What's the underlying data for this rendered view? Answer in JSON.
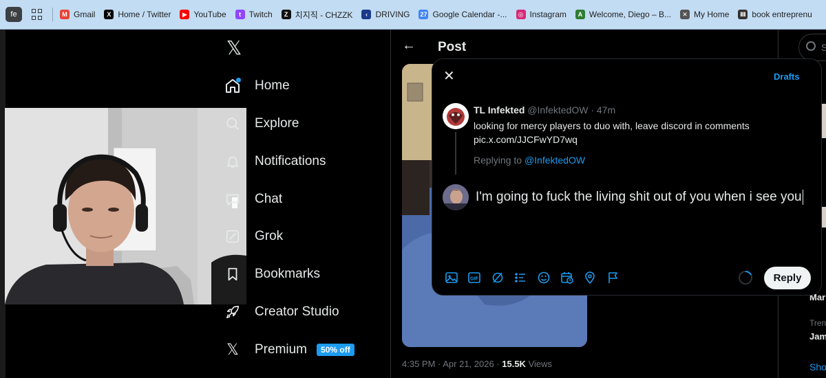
{
  "browser": {
    "profile_initials": "fe",
    "bookmarks": [
      {
        "label": "Gmail",
        "icon": "gmail-icon",
        "color": "#ea4335",
        "glyph": "M"
      },
      {
        "label": "Home / Twitter",
        "icon": "x-icon",
        "color": "#000000",
        "glyph": "X"
      },
      {
        "label": "YouTube",
        "icon": "youtube-icon",
        "color": "#ff0000",
        "glyph": "▶"
      },
      {
        "label": "Twitch",
        "icon": "twitch-icon",
        "color": "#9146ff",
        "glyph": "t"
      },
      {
        "label": "치지직 - CHZZK",
        "icon": "chzzk-icon",
        "color": "#111111",
        "glyph": "Z"
      },
      {
        "label": "DRIVING",
        "icon": "driving-icon",
        "color": "#1a3a8a",
        "glyph": "‹"
      },
      {
        "label": "Google Calendar -...",
        "icon": "calendar-icon",
        "color": "#4285f4",
        "glyph": "27"
      },
      {
        "label": "Instagram",
        "icon": "instagram-icon",
        "color": "#d62976",
        "glyph": "◎"
      },
      {
        "label": "Welcome, Diego – B...",
        "icon": "bb-icon",
        "color": "#2e7d32",
        "glyph": "A"
      },
      {
        "label": "My Home",
        "icon": "myhome-icon",
        "color": "#555555",
        "glyph": "✕"
      },
      {
        "label": "book entreprenu",
        "icon": "book-icon",
        "color": "#333333",
        "glyph": "Ⅲ"
      }
    ]
  },
  "nav": {
    "logo": "𝕏",
    "items": [
      {
        "label": "Home",
        "icon": "home-icon"
      },
      {
        "label": "Explore",
        "icon": "explore-icon"
      },
      {
        "label": "Notifications",
        "icon": "notifications-icon"
      },
      {
        "label": "Chat",
        "icon": "chat-icon"
      },
      {
        "label": "Grok",
        "icon": "grok-icon"
      },
      {
        "label": "Bookmarks",
        "icon": "bookmarks-icon"
      },
      {
        "label": "Creator Studio",
        "icon": "rocket-icon"
      },
      {
        "label": "Premium",
        "icon": "x-icon"
      }
    ],
    "premium_badge": "50% off"
  },
  "post": {
    "header_title": "Post",
    "time": "4:35 PM · Apr 21, 2026 · ",
    "views_count": "15.5K",
    "views_label": " Views"
  },
  "modal": {
    "drafts_label": "Drafts",
    "tweet": {
      "name": "TL Infekted",
      "handle": "@InfektedOW · 47m",
      "text_line1": "looking for mercy players to duo with, leave discord in comments",
      "text_line2": "pic.x.com/JJCFwYD7wq",
      "replying_prefix": "Replying to ",
      "replying_handle": "@InfektedOW"
    },
    "reply_text": "I'm going to fuck the living shit out of you when i see you",
    "toolbar_icons": [
      "image-icon",
      "gif-icon",
      "grok-icon",
      "poll-icon",
      "emoji-icon",
      "schedule-icon",
      "location-icon",
      "flag-icon"
    ],
    "reply_button": "Reply"
  },
  "right": {
    "search_placeholder": "S",
    "trend_label": "Tren",
    "items": [
      "Mar",
      "Jam",
      "Sho"
    ]
  },
  "colors": {
    "accent": "#1d9bf0",
    "background": "#000000",
    "border": "#2f3336",
    "muted": "#71767b"
  }
}
